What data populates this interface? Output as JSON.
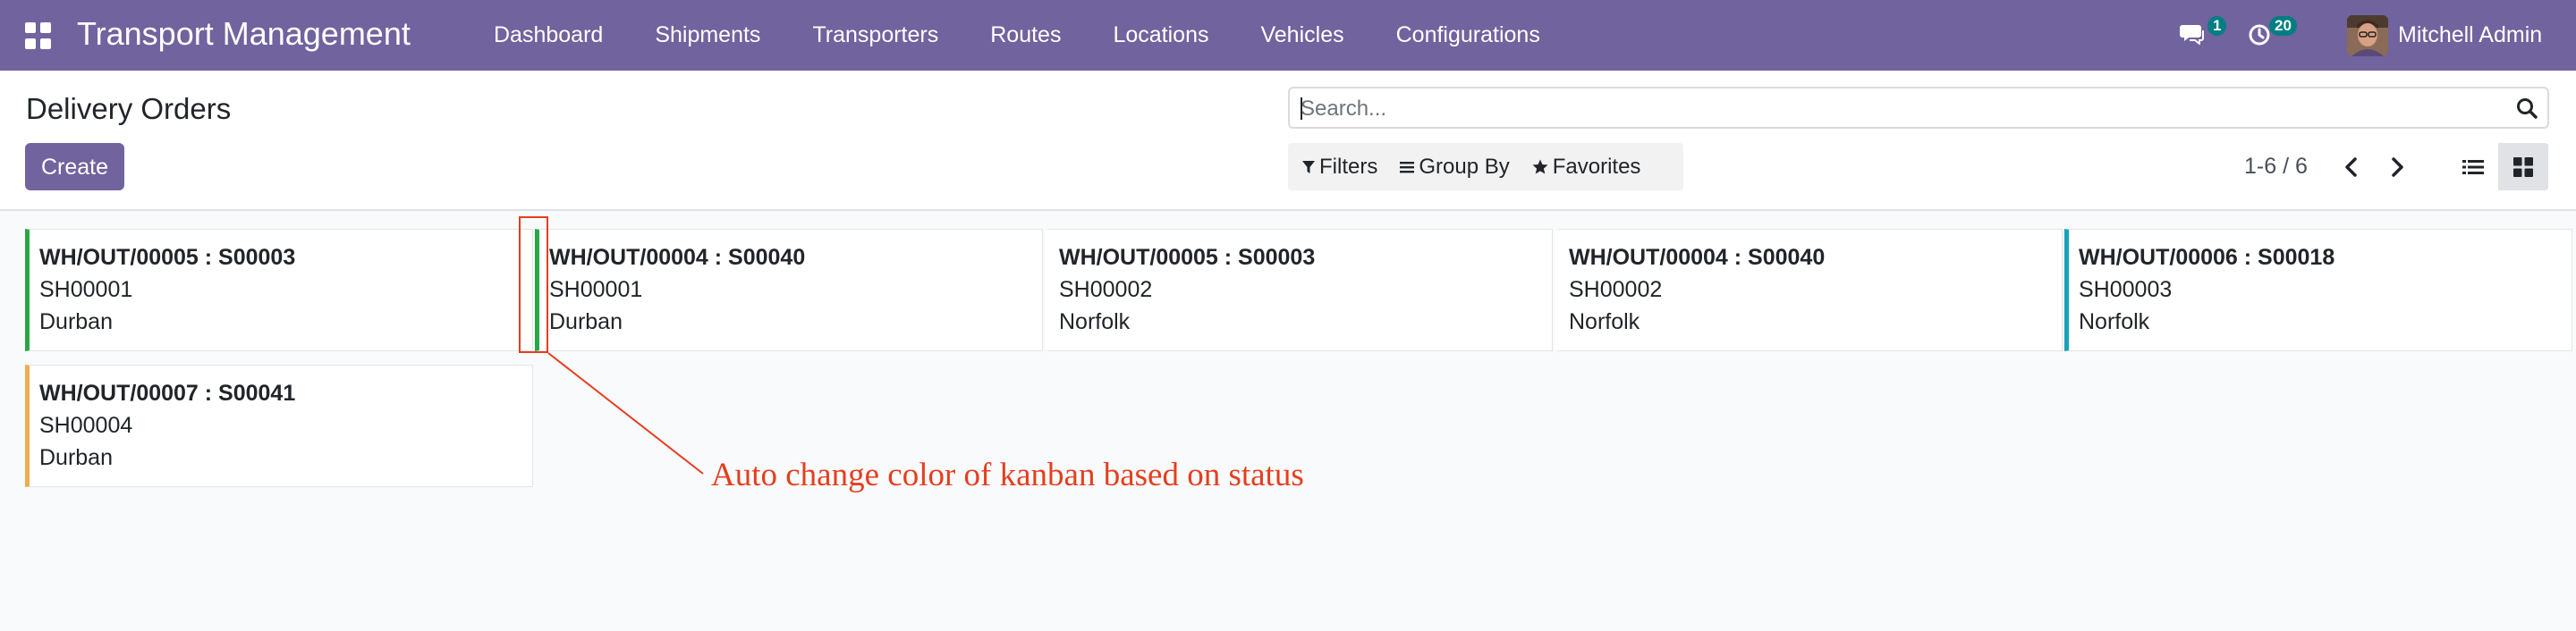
{
  "navbar": {
    "app_title": "Transport Management",
    "menu": [
      "Dashboard",
      "Shipments",
      "Transporters",
      "Routes",
      "Locations",
      "Vehicles",
      "Configurations"
    ],
    "messages_badge": "1",
    "activities_badge": "20",
    "user_name": "Mitchell Admin",
    "icons": [
      "apps-grid-icon",
      "chat-icon",
      "clock-icon"
    ]
  },
  "control_panel": {
    "title": "Delivery Orders",
    "create_label": "Create",
    "search_placeholder": "Search...",
    "filters_label": "Filters",
    "group_by_label": "Group By",
    "favorites_label": "Favorites",
    "pager_value": "1-6 / 6"
  },
  "cards": [
    {
      "title": "WH/OUT/00005 : S00003",
      "shipment": "SH00001",
      "location": "Durban",
      "status_color": "#28a745"
    },
    {
      "title": "WH/OUT/00004 : S00040",
      "shipment": "SH00001",
      "location": "Durban",
      "status_color": "#28a745"
    },
    {
      "title": "WH/OUT/00005 : S00003",
      "shipment": "SH00002",
      "location": "Norfolk",
      "status_color": "none"
    },
    {
      "title": "WH/OUT/00004 : S00040",
      "shipment": "SH00002",
      "location": "Norfolk",
      "status_color": "none"
    },
    {
      "title": "WH/OUT/00006 : S00018",
      "shipment": "SH00003",
      "location": "Norfolk",
      "status_color": "#17a2b8"
    },
    {
      "title": "WH/OUT/00007 : S00041",
      "shipment": "SH00004",
      "location": "Durban",
      "status_color": "#f0ad4e"
    }
  ],
  "annotation": {
    "text": "Auto change color of kanban based on status",
    "color": "#e53e1f"
  },
  "colors": {
    "navbar": "#71639e",
    "primary_button": "#71639e",
    "badge": "#017e84"
  }
}
